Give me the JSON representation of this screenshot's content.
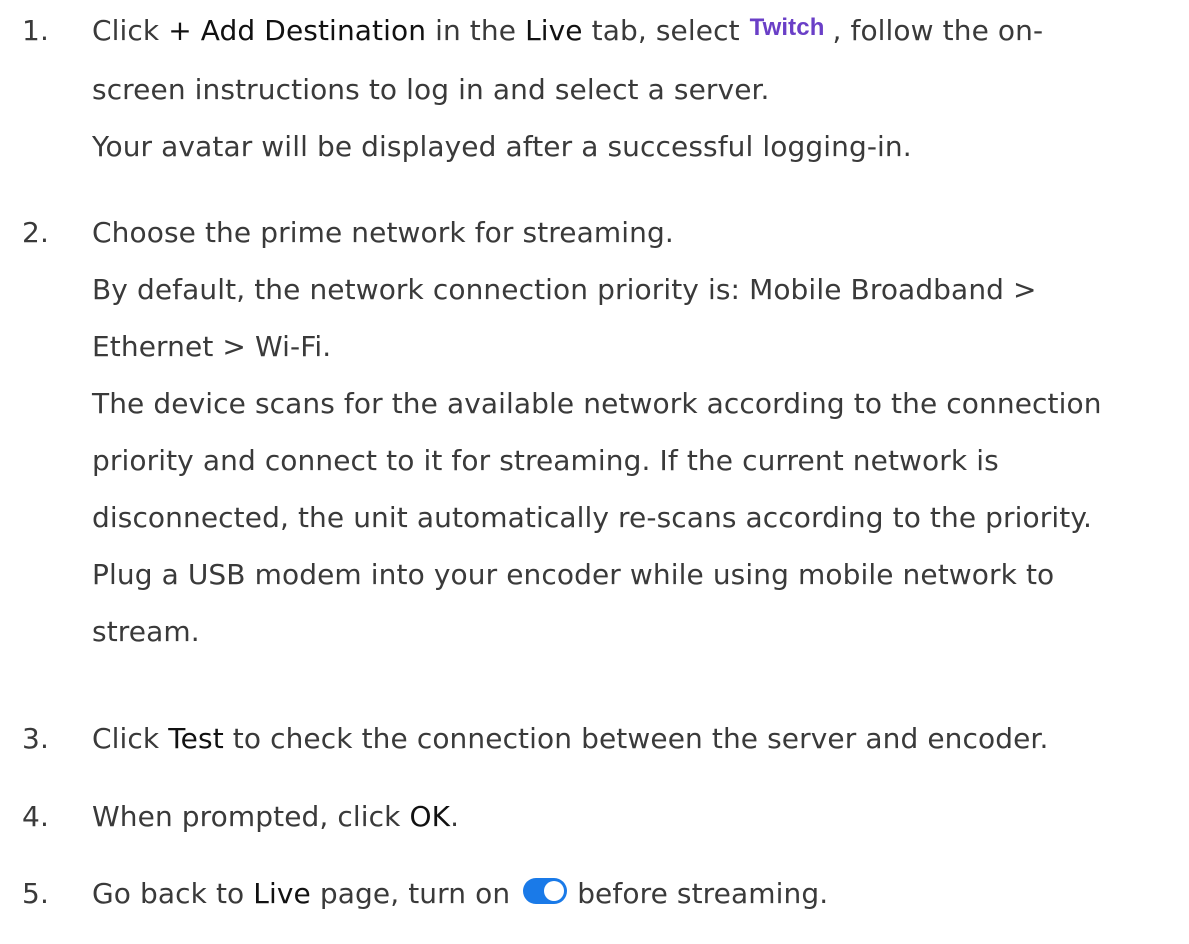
{
  "steps": [
    {
      "number": "1.",
      "lines": {
        "l1_a": "Click ",
        "l1_b": "+ Add Destination",
        "l1_c": " in the ",
        "l1_d": "Live",
        "l1_e": " tab, select",
        "l1_logo": "Twitch",
        "l1_f": ", follow the on-",
        "l2": "screen instructions to log in and select a server.",
        "l3": "Your avatar will be displayed after a successful logging-in."
      }
    },
    {
      "number": "2.",
      "lines": [
        "Choose the prime network for streaming.",
        "By default, the network connection priority is: Mobile Broadband >",
        "Ethernet > Wi-Fi.",
        "The device scans for the available network according to the connection",
        "priority and connect to it for streaming. If the current network is",
        "disconnected, the unit automatically re-scans according to the priority.",
        "Plug a USB modem into your encoder while using mobile network to",
        "stream."
      ]
    },
    {
      "number": "3.",
      "a": "Click ",
      "b": "Test",
      "c": " to check the connection between the server and encoder."
    },
    {
      "number": "4.",
      "a": "When prompted, click ",
      "b": "OK",
      "c": "."
    },
    {
      "number": "5.",
      "a": "Go back to ",
      "b": "Live",
      "c": " page, turn on",
      "d": "before streaming.",
      "toggle_state": "on",
      "toggle_color": "#1a7ae8"
    }
  ],
  "brand_colors": {
    "twitch": "#6a3fc7"
  }
}
